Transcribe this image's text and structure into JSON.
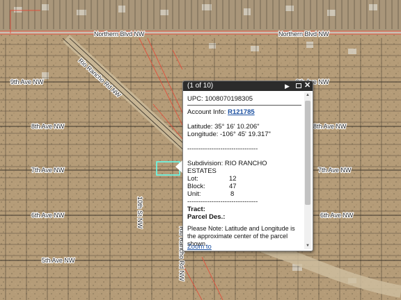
{
  "map": {
    "road_labels": {
      "northern_blvd_left": "Northern Blvd NW",
      "northern_blvd_right": "Northern Blvd NW",
      "ninth_ave_left": "9th Ave NW",
      "ninth_ave_right": "9th Ave NW",
      "eighth_ave_left": "8th Ave NW",
      "eighth_ave_right": "8th Ave NW",
      "seventh_ave_left": "7th Ave NW",
      "seventh_ave_right": "7th Ave NW",
      "sixth_ave_left": "6th Ave NW",
      "sixth_ave_right": "6th Ave NW",
      "fifth_ave_left": "5th Ave NW",
      "diagonal_road": "Rio Rancho Rd NW",
      "tenth_st": "10th St NW",
      "lower_diagonal": "Rio Rancho Rd NW"
    },
    "colors": {
      "parcel_line": "#2f2a22",
      "boundary_red": "#e0503c",
      "selected_parcel": "#66ffee"
    }
  },
  "popup": {
    "count": "(1 of 10)",
    "upc_label": "UPC:",
    "upc_value": "1008070198305",
    "account_label": "Account Info:",
    "account_value": "R121785",
    "latitude_label": "Latitude:",
    "latitude_value": "35° 16' 10.206\"",
    "longitude_label": "Longitude:",
    "longitude_value": "-106° 45' 19.317\"",
    "separator1": "--------------------------------",
    "subdivision_label": "Subdivision:",
    "subdivision_value_line1": "RIO RANCHO",
    "subdivision_value_line2": "ESTATES",
    "lot_label": "Lot:",
    "lot_value": "12",
    "block_label": "Block:",
    "block_value": "47",
    "unit_label": "Unit:",
    "unit_value": "8",
    "separator2": "--------------------------------",
    "tract_label": "Tract:",
    "parcel_label": "Parcel Des.:",
    "note_line1": "Please Note: Latitude and Longitude is",
    "note_line2": "the approximate center of the parcel",
    "note_line3": "shown.",
    "zoom_link": "Zoom to",
    "icons": [
      "next-icon",
      "maximize-icon",
      "close-icon"
    ]
  }
}
